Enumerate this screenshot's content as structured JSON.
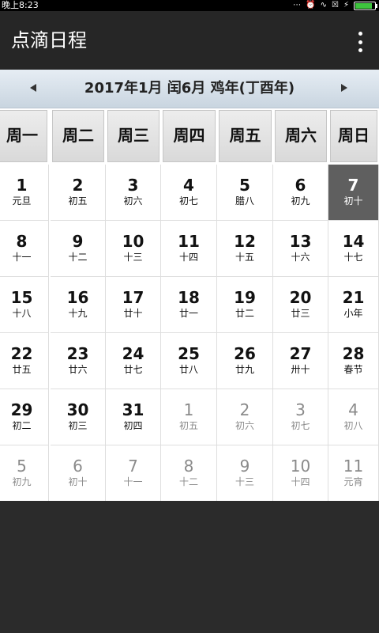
{
  "status": {
    "time": "晚上8:23",
    "icons": [
      "more-dots-icon",
      "alarm-icon",
      "wifi-icon",
      "sim-icon",
      "charging-icon",
      "battery-icon"
    ],
    "battery_level": 0.9
  },
  "app": {
    "title": "点滴日程"
  },
  "nav": {
    "title": "2017年1月  闰6月 鸡年(丁酉年)"
  },
  "weekdays": [
    "周一",
    "周二",
    "周三",
    "周四",
    "周五",
    "周六",
    "周日"
  ],
  "weeks": [
    [
      {
        "day": "1",
        "lunar": "元旦"
      },
      {
        "day": "2",
        "lunar": "初五"
      },
      {
        "day": "3",
        "lunar": "初六"
      },
      {
        "day": "4",
        "lunar": "初七"
      },
      {
        "day": "5",
        "lunar": "腊八"
      },
      {
        "day": "6",
        "lunar": "初九"
      },
      {
        "day": "7",
        "lunar": "初十",
        "today": true
      }
    ],
    [
      {
        "day": "8",
        "lunar": "十一"
      },
      {
        "day": "9",
        "lunar": "十二"
      },
      {
        "day": "10",
        "lunar": "十三"
      },
      {
        "day": "11",
        "lunar": "十四"
      },
      {
        "day": "12",
        "lunar": "十五"
      },
      {
        "day": "13",
        "lunar": "十六"
      },
      {
        "day": "14",
        "lunar": "十七"
      }
    ],
    [
      {
        "day": "15",
        "lunar": "十八"
      },
      {
        "day": "16",
        "lunar": "十九"
      },
      {
        "day": "17",
        "lunar": "廿十"
      },
      {
        "day": "18",
        "lunar": "廿一"
      },
      {
        "day": "19",
        "lunar": "廿二"
      },
      {
        "day": "20",
        "lunar": "廿三"
      },
      {
        "day": "21",
        "lunar": "小年"
      }
    ],
    [
      {
        "day": "22",
        "lunar": "廿五"
      },
      {
        "day": "23",
        "lunar": "廿六"
      },
      {
        "day": "24",
        "lunar": "廿七"
      },
      {
        "day": "25",
        "lunar": "廿八"
      },
      {
        "day": "26",
        "lunar": "廿九"
      },
      {
        "day": "27",
        "lunar": "卅十"
      },
      {
        "day": "28",
        "lunar": "春节"
      }
    ],
    [
      {
        "day": "29",
        "lunar": "初二"
      },
      {
        "day": "30",
        "lunar": "初三"
      },
      {
        "day": "31",
        "lunar": "初四"
      },
      {
        "day": "1",
        "lunar": "初五",
        "other": true
      },
      {
        "day": "2",
        "lunar": "初六",
        "other": true
      },
      {
        "day": "3",
        "lunar": "初七",
        "other": true
      },
      {
        "day": "4",
        "lunar": "初八",
        "other": true
      }
    ],
    [
      {
        "day": "5",
        "lunar": "初九",
        "other": true
      },
      {
        "day": "6",
        "lunar": "初十",
        "other": true
      },
      {
        "day": "7",
        "lunar": "十一",
        "other": true
      },
      {
        "day": "8",
        "lunar": "十二",
        "other": true
      },
      {
        "day": "9",
        "lunar": "十三",
        "other": true
      },
      {
        "day": "10",
        "lunar": "十四",
        "other": true
      },
      {
        "day": "11",
        "lunar": "元宵",
        "other": true
      }
    ]
  ]
}
